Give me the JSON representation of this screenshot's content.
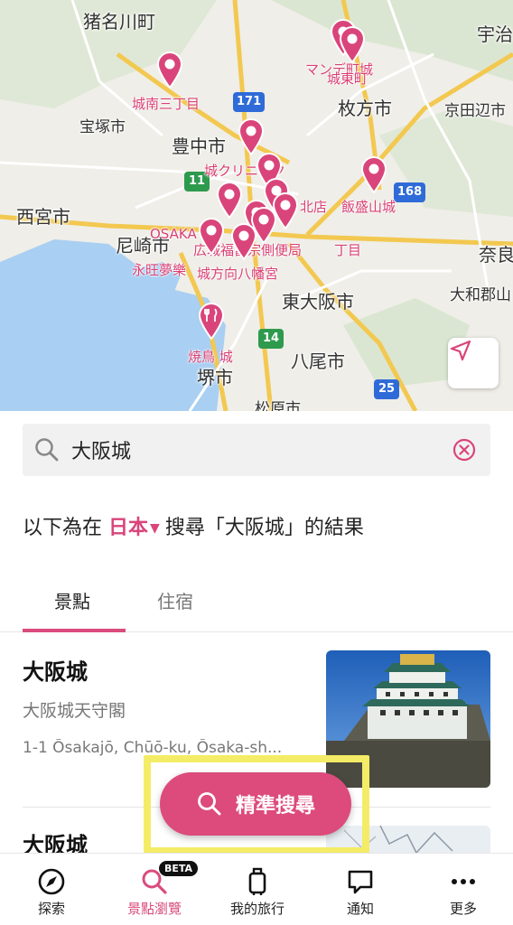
{
  "map": {
    "place_labels": [
      "猪名川町",
      "宇治",
      "宝塚市",
      "豊中市",
      "枚方市",
      "京田辺市",
      "西宮市",
      "尼崎市",
      "東大阪市",
      "奈良",
      "大和郡山",
      "八尾市",
      "堺市",
      "松原市"
    ],
    "poi_labels": [
      "城南三丁目",
      "マンデ町城",
      "城東町",
      "城クリニック",
      "飯盛山城",
      "北店",
      "OSAKA",
      "永旺夢樂",
      "城方向八幡宮",
      "丁目",
      "広城福富宗側便局",
      "焼鳥 城"
    ],
    "road_numbers": [
      "171",
      "11",
      "168",
      "14",
      "25"
    ],
    "locate_icon": "navigation-arrow-icon"
  },
  "search": {
    "query": "大阪城",
    "search_icon": "search-icon",
    "clear_icon": "clear-circle-icon"
  },
  "result_line": {
    "prefix": "以下為在",
    "country": "日本",
    "suffix": "搜尋「大阪城」的結果"
  },
  "tabs": [
    {
      "label": "景點",
      "active": true
    },
    {
      "label": "住宿",
      "active": false
    }
  ],
  "results": [
    {
      "title": "大阪城",
      "subtitle": "大阪城天守閣",
      "address": "1-1 Ōsakajō, Chūō-ku, Ōsaka-sh..."
    },
    {
      "title": "大阪城"
    }
  ],
  "fab": {
    "label": "精準搜尋",
    "icon": "search-icon"
  },
  "bottom_nav": [
    {
      "label": "探索",
      "icon": "compass-icon",
      "active": false
    },
    {
      "label": "景點瀏覽",
      "icon": "search-icon",
      "active": true,
      "badge": "BETA"
    },
    {
      "label": "我的旅行",
      "icon": "luggage-icon",
      "active": false
    },
    {
      "label": "通知",
      "icon": "chat-bubble-icon",
      "active": false
    },
    {
      "label": "更多",
      "icon": "more-dots-icon",
      "active": false
    }
  ],
  "colors": {
    "accent": "#dc4b7b",
    "highlight": "#f4ec66",
    "water": "#a9cff2"
  }
}
